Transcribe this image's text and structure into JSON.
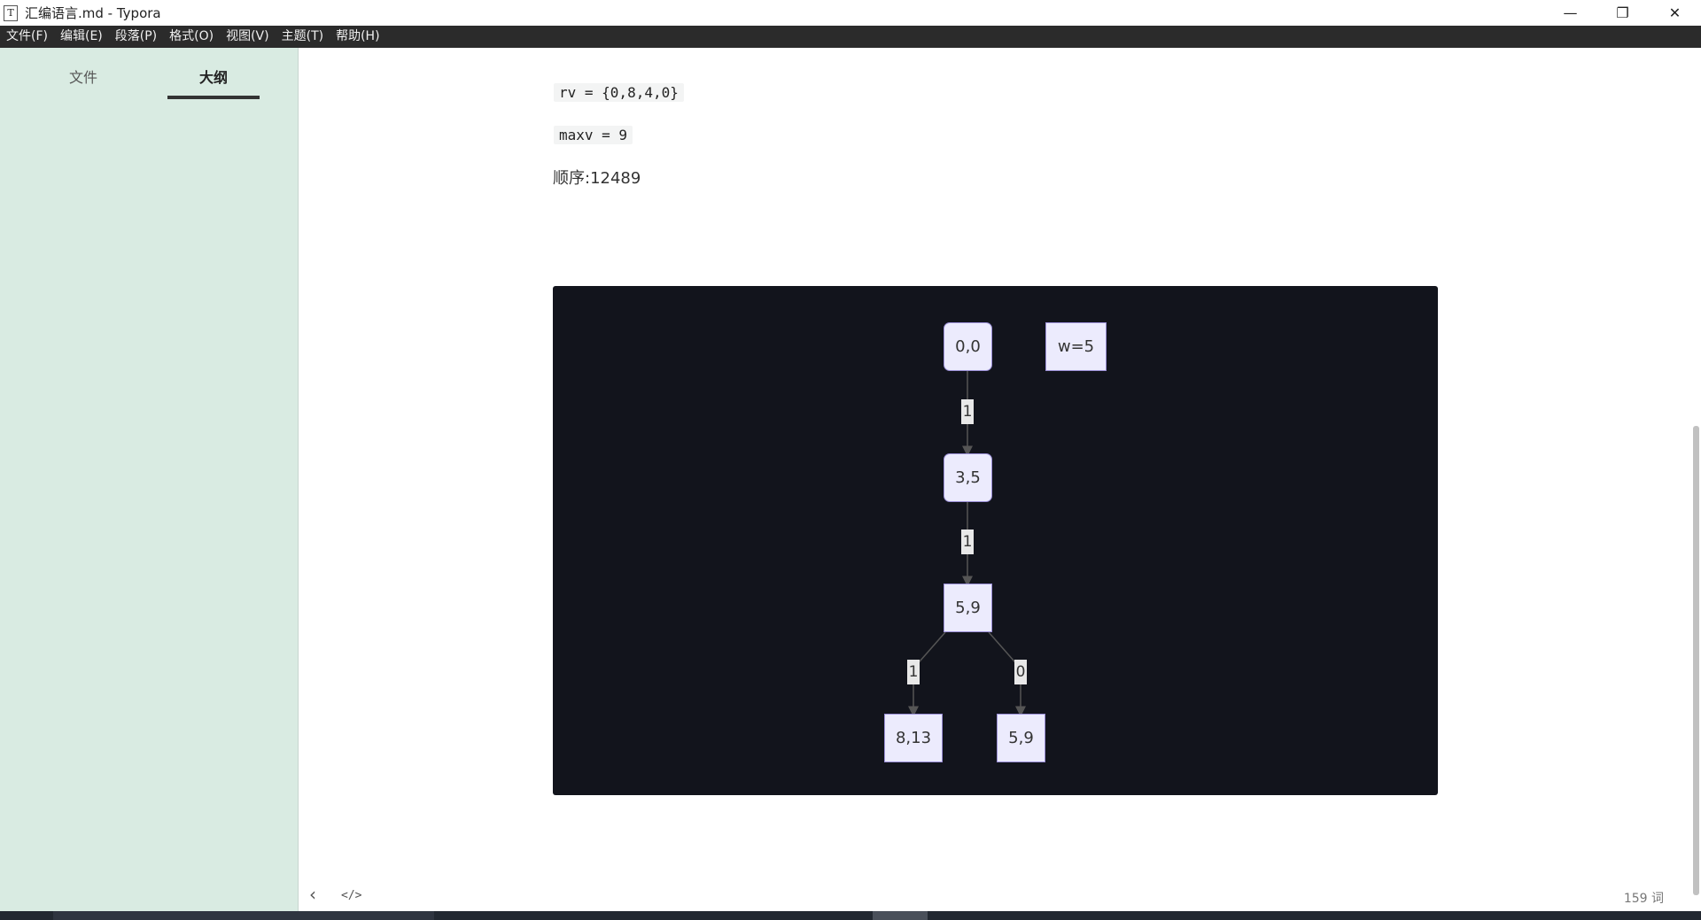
{
  "window": {
    "app_icon": "T",
    "title": "汇编语言.md - Typora",
    "controls": {
      "minimize": "—",
      "restore": "❐",
      "close": "✕"
    }
  },
  "menu": [
    "文件(F)",
    "编辑(E)",
    "段落(P)",
    "格式(O)",
    "视图(V)",
    "主题(T)",
    "帮助(H)"
  ],
  "sidebar": {
    "tabs": [
      {
        "label": "文件",
        "active": false
      },
      {
        "label": "大纲",
        "active": true
      }
    ]
  },
  "document": {
    "code_rv": "rv = {0,8,4,0}",
    "code_maxv": "maxv = 9",
    "order_text": "顺序:12489"
  },
  "diagram": {
    "nodes": {
      "n00": "0,0",
      "w": "w=5",
      "n35": "3,5",
      "n59": "5,9",
      "n813": "8,13",
      "n59b": "5,9"
    },
    "edges": {
      "e1": "1",
      "e2": "1",
      "e3": "1",
      "e4": "0"
    },
    "colors": {
      "background": "#12141c",
      "node_fill": "#ecebfd",
      "node_border": "#9a8fd6",
      "edge": "#555555"
    }
  },
  "bottombar": {
    "back_icon": "‹",
    "source_icon": "</>",
    "word_count": "159 词"
  }
}
